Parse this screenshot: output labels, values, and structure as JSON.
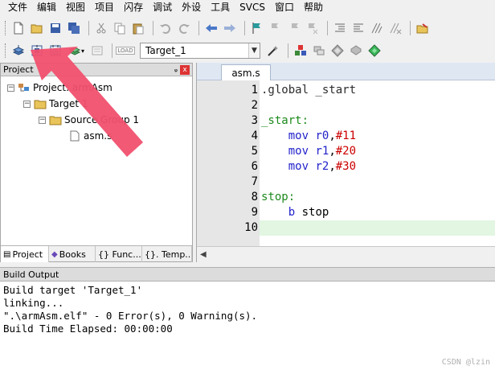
{
  "menu": [
    "文件",
    "编辑",
    "视图",
    "项目",
    "闪存",
    "调试",
    "外设",
    "工具",
    "SVCS",
    "窗口",
    "帮助"
  ],
  "toolbar2": {
    "target_value": "Target_1",
    "load_label": "LOAD"
  },
  "project_pane": {
    "title": "Project",
    "pin": "ᵩ",
    "close": "x",
    "tree": [
      {
        "label": "Project: armAsm",
        "icon": "project-icon",
        "level": 0
      },
      {
        "label": "Target 1",
        "icon": "folder-icon",
        "level": 1
      },
      {
        "label": "Source Group 1",
        "icon": "folder-icon",
        "level": 2
      },
      {
        "label": "asm.s",
        "icon": "file-icon",
        "level": 3
      }
    ],
    "tabs": [
      {
        "label": "Project",
        "icon": "project-tab-icon"
      },
      {
        "label": "Books",
        "icon": "books-icon"
      },
      {
        "label": "{} Func...",
        "icon": "functions-icon"
      },
      {
        "label": "{}. Temp...",
        "icon": "templates-icon"
      }
    ]
  },
  "editor": {
    "file_tab": "asm.s",
    "lines": [
      {
        "n": "1",
        "text": ".global _start"
      },
      {
        "n": "2",
        "text": ""
      },
      {
        "n": "3",
        "text": "_start:"
      },
      {
        "n": "4",
        "text": "    mov r0,#11"
      },
      {
        "n": "5",
        "text": "    mov r1,#20"
      },
      {
        "n": "6",
        "text": "    mov r2,#30"
      },
      {
        "n": "7",
        "text": ""
      },
      {
        "n": "8",
        "text": "stop:"
      },
      {
        "n": "9",
        "text": "    b stop"
      },
      {
        "n": "10",
        "text": ""
      }
    ]
  },
  "build_output": {
    "title": "Build Output",
    "lines": [
      "Build target 'Target_1'",
      "linking...",
      "\".\\armAsm.elf\" - 0 Error(s), 0 Warning(s).",
      "Build Time Elapsed:  00:00:00"
    ]
  },
  "watermark": "CSDN @lzin",
  "colors": {
    "label_green": "#1d8a1d",
    "instruction_blue": "#2222cc",
    "number_red": "#cc0000",
    "current_line": "#e2f6e2",
    "arrow_red": "#f0506e"
  }
}
